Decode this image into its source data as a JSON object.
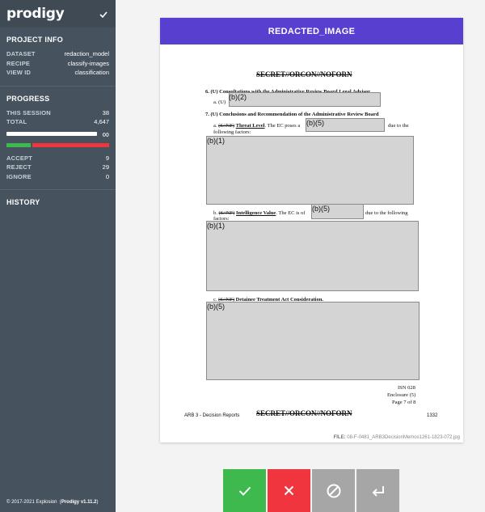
{
  "app": {
    "logo": "prodigy"
  },
  "project_info": {
    "title": "PROJECT INFO",
    "rows": [
      {
        "key": "DATASET",
        "value": "redaction_model"
      },
      {
        "key": "RECIPE",
        "value": "classify-images"
      },
      {
        "key": "VIEW ID",
        "value": "classification"
      }
    ]
  },
  "progress": {
    "title": "PROGRESS",
    "this_session_label": "THIS SESSION",
    "this_session": "38",
    "total_label": "TOTAL",
    "total": "4,647",
    "infinity": "∞",
    "accept_label": "ACCEPT",
    "accept": "9",
    "reject_label": "REJECT",
    "reject": "29",
    "ignore_label": "IGNORE",
    "ignore": "0",
    "accept_fraction": 0.237,
    "reject_fraction": 0.763
  },
  "history": {
    "title": "HISTORY"
  },
  "footer": {
    "copyright": "© 2017-2021 Explosion",
    "version": "Prodigy v1.11.2"
  },
  "card": {
    "header": "REDACTED_IMAGE",
    "file_label": "FILE:",
    "file_name": "08-F-0481_ARB3DecisionMemos1261-1823-072.jpg"
  },
  "document": {
    "classification": "SECRET//ORCON//NOFORN",
    "item6": "6.  (U) Consultations with the Administrative Review Board Legal Advisor",
    "item6a": "a.  (U)",
    "item7": "7.  (U) Conclusions and Recommendation of the Administrative Review Board",
    "item7a_prefix": "a.",
    "item7a_mark": "(S//NF)",
    "item7a_title": "Threat Level",
    "item7a_text": ".  The EC poses a",
    "item7a_tail": "due to the",
    "item7a_line2": "following factors:",
    "item7b_prefix": "b.",
    "item7b_mark": "(S//NF)",
    "item7b_title": "Intelligence Value",
    "item7b_text": ".  The EC is of",
    "item7b_tail": "due to the following",
    "item7b_line2": "factors:",
    "item7c_prefix": "c.",
    "item7c_mark": "(S//NF)",
    "item7c_title": "Detainee Treatment Act Consideration.",
    "redaction_b2": "(b)(2)",
    "redaction_b5a": "(b)(5)",
    "redaction_b1a": "(b)(1)",
    "redaction_b5b": "(b)(5)",
    "redaction_b1b": "(b)(1)",
    "redaction_b5c": "(b)(5)",
    "isn": "ISN 028",
    "enclosure": "Enclosure (5)",
    "page": "Page 7 of 8",
    "footer_left": "ARB 3 - Decision Reports",
    "footer_right": "1332"
  },
  "actions": {
    "accept": "accept-icon",
    "reject": "reject-icon",
    "ignore": "ignore-icon",
    "undo": "undo-icon"
  }
}
